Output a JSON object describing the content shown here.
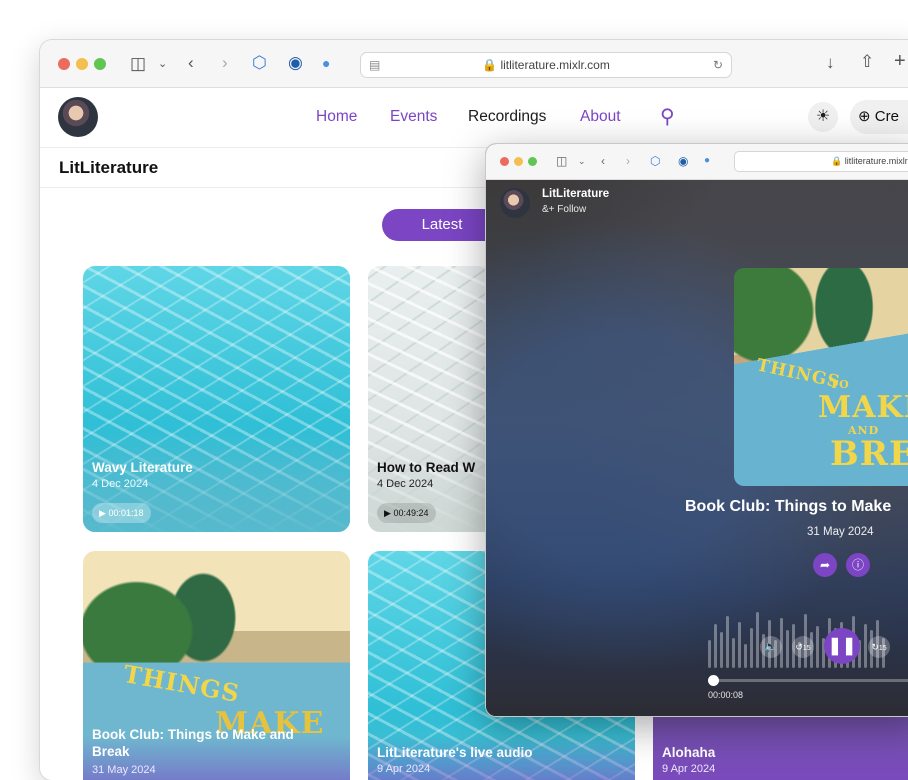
{
  "back_window": {
    "url": "litliterature.mixlr.com",
    "nav": {
      "items": [
        {
          "label": "Home"
        },
        {
          "label": "Events"
        },
        {
          "label": "Recordings"
        },
        {
          "label": "About"
        }
      ],
      "active": "Recordings",
      "create_label": "Cre"
    },
    "page_title": "LitLiterature",
    "tab_latest": "Latest",
    "cards": [
      {
        "title": "Wavy Literature",
        "date": "4 Dec 2024",
        "duration": "00:01:18"
      },
      {
        "title": "How to Read W",
        "date": "4 Dec 2024",
        "duration": "00:49:24"
      },
      {
        "title": "Book Club: Things to Make and Break",
        "date": "31 May 2024"
      },
      {
        "title": "LitLiterature's live audio",
        "date": "9 Apr 2024"
      },
      {
        "title": "Alohaha",
        "date": "9 Apr 2024"
      }
    ]
  },
  "front_window": {
    "url": "litliterature.mixlr.",
    "channel": {
      "name": "LitLiterature",
      "follow_label": "Follow"
    },
    "recording": {
      "title": "Book Club: Things to Make",
      "date": "31 May 2024",
      "art_text": [
        "THINGS",
        "TO",
        "MAKE",
        "AND",
        "BREA"
      ]
    },
    "player": {
      "elapsed": "00:00:08",
      "skip_back": "15",
      "skip_forward": "15",
      "progress": 0.02
    }
  },
  "colors": {
    "accent": "#7b45c4",
    "traffic_red": "#ed6a5e",
    "traffic_yellow": "#f5bf4f",
    "traffic_green": "#61c554"
  }
}
